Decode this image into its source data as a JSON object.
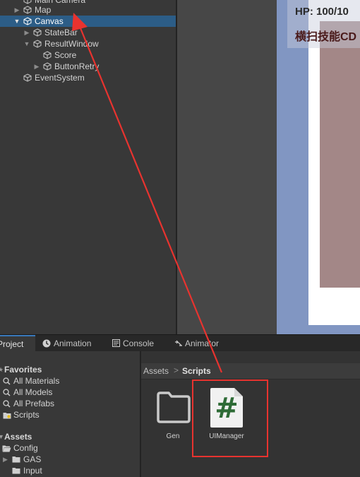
{
  "hierarchy": {
    "items": [
      {
        "label": "Main Camera",
        "expanded": null
      },
      {
        "label": "Map",
        "expanded": false
      },
      {
        "label": "Canvas",
        "expanded": true,
        "selected": true
      },
      {
        "label": "StateBar",
        "expanded": false
      },
      {
        "label": "ResultWindow",
        "expanded": true
      },
      {
        "label": "Score",
        "expanded": null
      },
      {
        "label": "ButtonRetry",
        "expanded": false
      },
      {
        "label": "EventSystem",
        "expanded": null
      }
    ]
  },
  "game_view": {
    "hp_text": "HP: 100/10",
    "cd_text": "横扫技能CD"
  },
  "bottom_tabs": [
    {
      "label": "Project",
      "icon": "folder-icon",
      "active": true
    },
    {
      "label": "Animation",
      "icon": "clock-icon",
      "active": false
    },
    {
      "label": "Console",
      "icon": "console-icon",
      "active": false
    },
    {
      "label": "Animator",
      "icon": "animator-icon",
      "active": false
    }
  ],
  "project_sidebar": {
    "favorites_header": "Favorites",
    "favorites": [
      "All Materials",
      "All Models",
      "All Prefabs",
      "Scripts"
    ],
    "assets_header": "Assets",
    "assets": [
      "Config",
      "GAS",
      "Input"
    ]
  },
  "breadcrumb": {
    "root": "Assets",
    "separator": ">",
    "current": "Scripts"
  },
  "assets_grid": [
    {
      "label": "Gen",
      "type": "folder"
    },
    {
      "label": "UIManager",
      "type": "csharp-script",
      "glyph": "#",
      "highlighted": true
    }
  ],
  "colors": {
    "selection": "#2c5d87",
    "annotation_red": "#e8332f",
    "script_green": "#2e6b36",
    "game_background": "#8196c2"
  }
}
